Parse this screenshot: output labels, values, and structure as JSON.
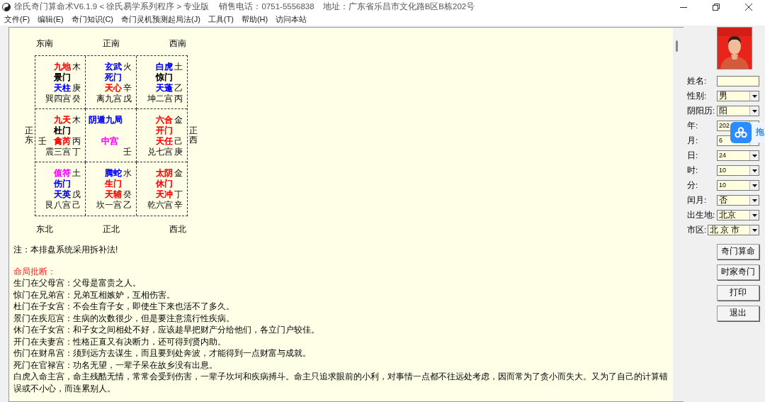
{
  "window": {
    "title": "徐氏奇门算命术V6.1.9  < 徐氏易学系列程序 > 专业版",
    "phone": "销售电话：0751-5556838",
    "address": "地址：广东省乐昌市文化路B区B栋202号"
  },
  "menu": [
    "文件(F)",
    "编辑(E)",
    "奇门知识(C)",
    "奇门灵机预测起局法(J)",
    "工具(T)",
    "帮助(H)",
    "访问本站"
  ],
  "chart": {
    "directions_top": [
      "东南",
      "正南",
      "西南"
    ],
    "side_left": "正东",
    "side_right": "正西",
    "directions_bottom": [
      "东北",
      "正北",
      "西北"
    ],
    "palaces": [
      {
        "kind": "palace",
        "god": {
          "text": "九地",
          "color": "#ff0000"
        },
        "god_element": "木",
        "door": {
          "text": "景门",
          "color": "#000000"
        },
        "star": {
          "text": "天柱",
          "color": "#0000ff"
        },
        "star_stem": "庚",
        "name": "巽四宫",
        "name_stem": "癸"
      },
      {
        "kind": "palace",
        "god": {
          "text": "玄武",
          "color": "#0000ff"
        },
        "god_element": "火",
        "door": {
          "text": "死门",
          "color": "#0000ff"
        },
        "star": {
          "text": "天心",
          "color": "#ff0000"
        },
        "star_stem": "辛",
        "name": "离九宫",
        "name_stem": "戊"
      },
      {
        "kind": "palace",
        "god": {
          "text": "白虎",
          "color": "#0000ff"
        },
        "god_element": "土",
        "door": {
          "text": "惊门",
          "color": "#000000"
        },
        "star": {
          "text": "天蓬",
          "color": "#0000ff"
        },
        "star_stem": "乙",
        "name": "坤二宫",
        "name_stem": "丙"
      },
      {
        "kind": "palace",
        "god": {
          "text": "九天",
          "color": "#ff0000"
        },
        "god_element": "木",
        "door": {
          "text": "杜门",
          "color": "#000000"
        },
        "prefix": "壬",
        "star": {
          "text": "禽芮",
          "color": "#ff0000"
        },
        "star_stem": "丙",
        "name": "震三宫",
        "name_stem": "丁"
      },
      {
        "kind": "center",
        "title": {
          "text": "阴遁九局",
          "color": "#0000ff"
        },
        "name": {
          "text": "中宫",
          "color": "#ff00ff"
        },
        "stem": "壬"
      },
      {
        "kind": "palace",
        "god": {
          "text": "六合",
          "color": "#ff0000"
        },
        "god_element": "金",
        "door": {
          "text": "开门",
          "color": "#ff0000"
        },
        "star": {
          "text": "天任",
          "color": "#ff0000"
        },
        "star_stem": "己",
        "name": "兑七宫",
        "name_stem": "庚"
      },
      {
        "kind": "palace",
        "god": {
          "text": "值符",
          "color": "#ff00ff"
        },
        "god_element": "土",
        "door": {
          "text": "伤门",
          "color": "#0000ff"
        },
        "star": {
          "text": "天英",
          "color": "#0000ff"
        },
        "star_stem": "戊",
        "name": "艮八宫",
        "name_stem": "己"
      },
      {
        "kind": "palace",
        "god": {
          "text": "腾蛇",
          "color": "#0000ff"
        },
        "god_element": "水",
        "door": {
          "text": "生门",
          "color": "#ff0000"
        },
        "star": {
          "text": "天辅",
          "color": "#ff0000"
        },
        "star_stem": "癸",
        "name": "坎一宫",
        "name_stem": "乙"
      },
      {
        "kind": "palace",
        "god": {
          "text": "太阴",
          "color": "#ff0000"
        },
        "god_element": "金",
        "door": {
          "text": "休门",
          "color": "#ff0000"
        },
        "star": {
          "text": "天冲",
          "color": "#ff0000"
        },
        "star_stem": "丁",
        "name": "乾六宫",
        "name_stem": "辛"
      }
    ]
  },
  "note": "注：本排盘系统采用拆补法!",
  "section": {
    "heading": "命局批断：",
    "lines": [
      "生门在父母宫：父母是富贵之人。",
      "惊门在兄弟宫：兄弟互相嫉妒，互相伤害。",
      "杜门在子女宫：不会生育子女，即使生下来也活不了多久。",
      "景门在疾厄宫：生病的次数很少，但是要注意流行性疾病。",
      "休门在子女宫：和子女之间相处不好，应该趁早把财产分给他们，各立门户较佳。",
      "开门在夫妻宫：性格正直又有决断力，还可得到贤内助。",
      "伤门在财帛宫：须到远方去谋生，而且要到处奔波，才能得到一点财富与成就。",
      "死门在官禄宫：功名无望，一辈子呆在故乡没有出息。",
      "白虎入命主宫，命主残酷无情，常常会受到伤害，一辈子坎坷和疾病搏斗。命主只追求眼前的小利，对事情一点都不往远处考虑，因而常为了贪小而失大。又为了自己的计算错误或不小心，而连累别人。"
    ]
  },
  "form": {
    "fields": [
      {
        "label": "姓名:",
        "kind": "text"
      },
      {
        "label": "性别:",
        "kind": "select",
        "value": "男"
      },
      {
        "label": "阴阳历:",
        "kind": "select",
        "value": "阳"
      },
      {
        "label": "年:",
        "kind": "select",
        "value": "202"
      },
      {
        "label": "月:",
        "kind": "select",
        "value": "6"
      },
      {
        "label": "日:",
        "kind": "select",
        "value": "24"
      },
      {
        "label": "时:",
        "kind": "select",
        "value": "10"
      },
      {
        "label": "分:",
        "kind": "select",
        "value": "10"
      },
      {
        "label": "闰月:",
        "kind": "select",
        "value": "否"
      },
      {
        "label": "出生地:",
        "kind": "select",
        "value": "北京"
      },
      {
        "label": "市区:",
        "kind": "select",
        "value": "北 京 市",
        "wide": true
      }
    ],
    "buttons": [
      "奇门算命",
      "时家奇门",
      "打印",
      "退出"
    ]
  },
  "overlay": {
    "label": "拖"
  }
}
